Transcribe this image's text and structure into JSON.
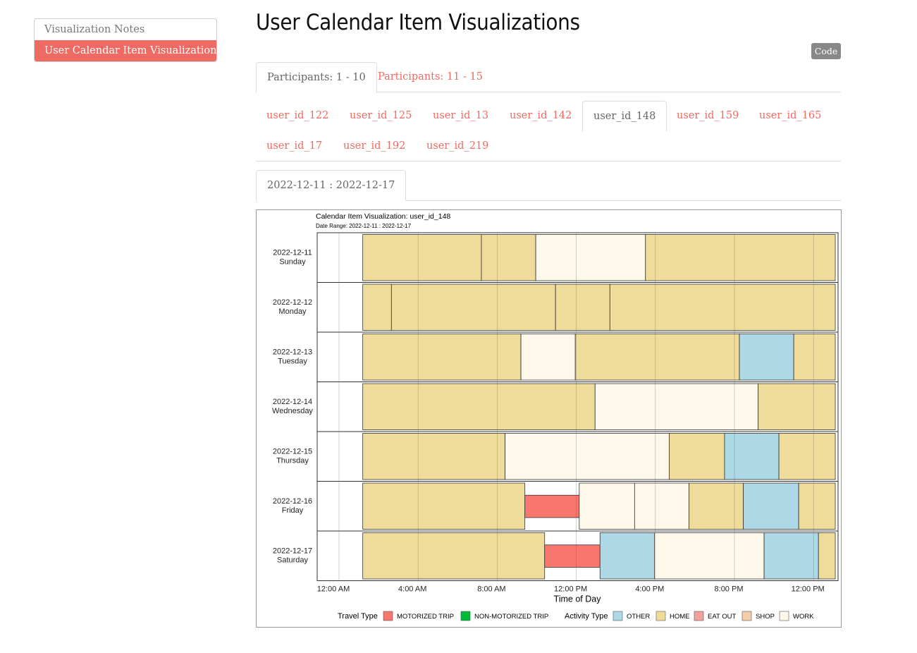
{
  "toc": {
    "items": [
      {
        "label": "Visualization Notes",
        "active": false
      },
      {
        "label": "User Calendar Item Visualizations",
        "active": true
      }
    ]
  },
  "page": {
    "title": "User Calendar Item Visualizations",
    "code_button": "Code"
  },
  "group_tabs": [
    {
      "label": "Participants: 1 - 10",
      "active": true
    },
    {
      "label": "Participants: 11 - 15",
      "active": false
    }
  ],
  "user_tabs": [
    {
      "label": "user_id_122",
      "active": false
    },
    {
      "label": "user_id_125",
      "active": false
    },
    {
      "label": "user_id_13",
      "active": false
    },
    {
      "label": "user_id_142",
      "active": false
    },
    {
      "label": "user_id_148",
      "active": true
    },
    {
      "label": "user_id_159",
      "active": false
    },
    {
      "label": "user_id_165",
      "active": false
    },
    {
      "label": "user_id_17",
      "active": false
    },
    {
      "label": "user_id_192",
      "active": false
    },
    {
      "label": "user_id_219",
      "active": false
    }
  ],
  "date_tabs": [
    {
      "label": "2022-12-11 : 2022-12-17",
      "active": true
    }
  ],
  "chart_data": {
    "type": "bar",
    "title": "Calendar Item Visualization: user_id_148",
    "subtitle": "Date Range: 2022-12-11 : 2022-12-17",
    "xlabel": "Time of Day",
    "ylabel": "",
    "xlim": [
      0,
      24
    ],
    "x_ticks": [
      "12:00 AM",
      "4:00 AM",
      "8:00 AM",
      "12:00 PM",
      "4:00 PM",
      "8:00 PM",
      "12:00 PM"
    ],
    "x_tick_hours": [
      0,
      4,
      8,
      12,
      16,
      20,
      24
    ],
    "grid": true,
    "legend_position": "bottom",
    "days": [
      {
        "date": "2022-12-11",
        "weekday": "Sunday",
        "items": [
          {
            "category": "HOME",
            "start": 1.2,
            "end": 7.2
          },
          {
            "category": "HOME",
            "start": 7.2,
            "end": 9.95
          },
          {
            "category": "WORK",
            "start": 9.95,
            "end": 15.5
          },
          {
            "category": "HOME",
            "start": 15.5,
            "end": 25.1
          }
        ]
      },
      {
        "date": "2022-12-12",
        "weekday": "Monday",
        "items": [
          {
            "category": "HOME",
            "start": 1.2,
            "end": 2.65
          },
          {
            "category": "HOME",
            "start": 2.65,
            "end": 10.95
          },
          {
            "category": "HOME",
            "start": 10.95,
            "end": 13.7
          },
          {
            "category": "HOME",
            "start": 13.7,
            "end": 25.1
          }
        ]
      },
      {
        "date": "2022-12-13",
        "weekday": "Tuesday",
        "items": [
          {
            "category": "HOME",
            "start": 1.2,
            "end": 9.2
          },
          {
            "category": "WORK",
            "start": 9.2,
            "end": 11.95
          },
          {
            "category": "HOME",
            "start": 11.95,
            "end": 20.25
          },
          {
            "category": "OTHER",
            "start": 20.25,
            "end": 23.0
          },
          {
            "category": "HOME",
            "start": 23.0,
            "end": 25.1
          }
        ]
      },
      {
        "date": "2022-12-14",
        "weekday": "Wednesday",
        "items": [
          {
            "category": "HOME",
            "start": 1.2,
            "end": 12.95
          },
          {
            "category": "WORK",
            "start": 12.95,
            "end": 21.2
          },
          {
            "category": "HOME",
            "start": 21.2,
            "end": 25.1
          }
        ]
      },
      {
        "date": "2022-12-15",
        "weekday": "Thursday",
        "items": [
          {
            "category": "HOME",
            "start": 1.2,
            "end": 8.4
          },
          {
            "category": "WORK",
            "start": 8.4,
            "end": 16.7
          },
          {
            "category": "HOME",
            "start": 16.7,
            "end": 19.5
          },
          {
            "category": "OTHER",
            "start": 19.5,
            "end": 22.25
          },
          {
            "category": "HOME",
            "start": 22.25,
            "end": 25.1
          }
        ]
      },
      {
        "date": "2022-12-16",
        "weekday": "Friday",
        "items": [
          {
            "category": "HOME",
            "start": 1.2,
            "end": 9.4
          },
          {
            "category": "MOTORIZED TRIP",
            "start": 9.4,
            "end": 12.15
          },
          {
            "category": "WORK",
            "start": 12.15,
            "end": 14.95
          },
          {
            "category": "WORK",
            "start": 14.95,
            "end": 17.7
          },
          {
            "category": "HOME",
            "start": 17.7,
            "end": 20.45
          },
          {
            "category": "OTHER",
            "start": 20.45,
            "end": 23.25
          },
          {
            "category": "HOME",
            "start": 23.25,
            "end": 25.1
          }
        ]
      },
      {
        "date": "2022-12-17",
        "weekday": "Saturday",
        "items": [
          {
            "category": "HOME",
            "start": 1.2,
            "end": 10.4
          },
          {
            "category": "MOTORIZED TRIP",
            "start": 10.4,
            "end": 13.2
          },
          {
            "category": "OTHER",
            "start": 13.2,
            "end": 15.95
          },
          {
            "category": "WORK",
            "start": 15.95,
            "end": 21.5
          },
          {
            "category": "OTHER",
            "start": 21.5,
            "end": 24.25
          },
          {
            "category": "HOME",
            "start": 24.25,
            "end": 25.1
          }
        ]
      }
    ],
    "legend": {
      "travel_title": "Travel Type",
      "travel": [
        {
          "name": "MOTORIZED TRIP",
          "color": "#f8766d"
        },
        {
          "name": "NON-MOTORIZED TRIP",
          "color": "#00ba38"
        }
      ],
      "activity_title": "Activity Type",
      "activity": [
        {
          "name": "OTHER",
          "color": "#add8e6"
        },
        {
          "name": "HOME",
          "color": "#f0dc9a"
        },
        {
          "name": "EAT OUT",
          "color": "#f4a09c"
        },
        {
          "name": "SHOP",
          "color": "#f2cfa7"
        },
        {
          "name": "WORK",
          "color": "#fdf8ea"
        }
      ]
    },
    "colors": {
      "HOME": "#f0dc9a",
      "WORK": "#fdf8ea",
      "OTHER": "#add8e6",
      "MOTORIZED TRIP": "#f8766d",
      "NON-MOTORIZED TRIP": "#00ba38",
      "EAT OUT": "#f4a09c",
      "SHOP": "#f2cfa7"
    }
  }
}
